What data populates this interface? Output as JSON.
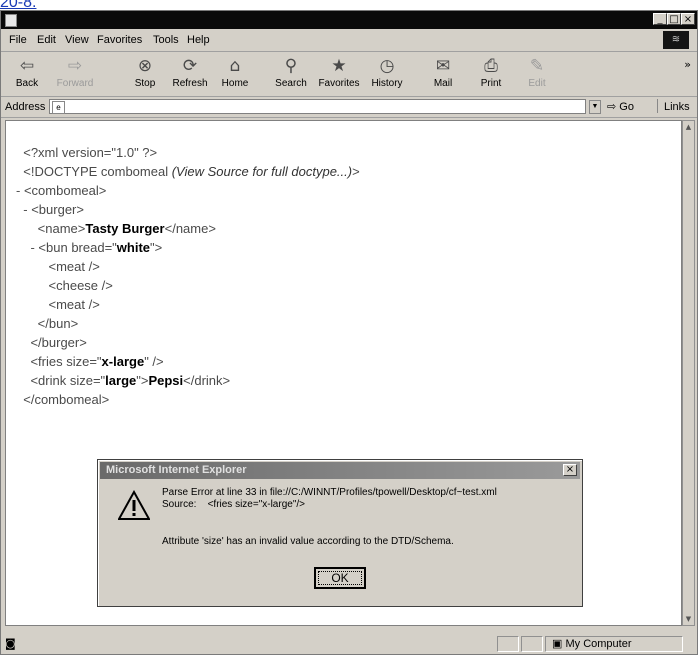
{
  "caption": "20-8.",
  "window": {
    "minimize": "_",
    "maximize": "□",
    "close": "×"
  },
  "menu": [
    "File",
    "Edit",
    "View",
    "Favorites",
    "Tools",
    "Help"
  ],
  "toolbar": [
    {
      "label": "Back",
      "icon": "back-arrow-icon",
      "glyph": "⇦"
    },
    {
      "label": "Forward",
      "icon": "forward-arrow-icon",
      "glyph": "⇨"
    },
    {
      "label": "Stop",
      "icon": "stop-icon",
      "glyph": "⊗"
    },
    {
      "label": "Refresh",
      "icon": "refresh-icon",
      "glyph": "⟳"
    },
    {
      "label": "Home",
      "icon": "home-icon",
      "glyph": "⌂"
    },
    {
      "label": "Search",
      "icon": "search-icon",
      "glyph": "⚲"
    },
    {
      "label": "Favorites",
      "icon": "favorites-icon",
      "glyph": "★"
    },
    {
      "label": "History",
      "icon": "history-icon",
      "glyph": "◷"
    },
    {
      "label": "Mail",
      "icon": "mail-icon",
      "glyph": "✉"
    },
    {
      "label": "Print",
      "icon": "print-icon",
      "glyph": "⎙"
    },
    {
      "label": "Edit",
      "icon": "edit-icon",
      "glyph": "✎"
    }
  ],
  "toolbar_more": "»",
  "address": {
    "label": "Address",
    "value": "",
    "go_label": "Go",
    "links_label": "Links"
  },
  "xml": {
    "l1": "<?xml version=\"1.0\" ?>",
    "l2_tag": "<!DOCTYPE combomeal ",
    "l2_note": "(View Source for full doctype...)",
    "l2_end": ">",
    "l3": "<combomeal>",
    "l4": "<burger>",
    "l5_open": "<name>",
    "l5_val": "Tasty Burger",
    "l5_close": "</name>",
    "l6_open": "<bun bread=\"",
    "l6_val": "white",
    "l6_close": "\">",
    "l7": "<meat />",
    "l8": "<cheese />",
    "l9": "<meat />",
    "l10": "</bun>",
    "l11": "</burger>",
    "l12_open": "<fries size=\"",
    "l12_val": "x-large",
    "l12_close": "\" />",
    "l13_open": "<drink size=\"",
    "l13_val": "large",
    "l13_mid": "\">",
    "l13_text": "Pepsi",
    "l13_close": "</drink>",
    "l14": "</combomeal>",
    "minus": "-"
  },
  "dialog": {
    "title": "Microsoft Internet Explorer",
    "line1": "Parse Error at line 33 in file://C:/WINNT/Profiles/tpowell/Desktop/cf~test.xml",
    "line2": "Source:    <fries size=\"x-large\"/>",
    "line3": "Attribute 'size' has an invalid value according to the DTD/Schema.",
    "ok": "OK",
    "close": "×"
  },
  "status": {
    "zone": "My Computer"
  },
  "colors": {
    "titlebar": "#0a0a0a",
    "chrome": "#d4d0c8",
    "link": "#1a3ab5"
  }
}
